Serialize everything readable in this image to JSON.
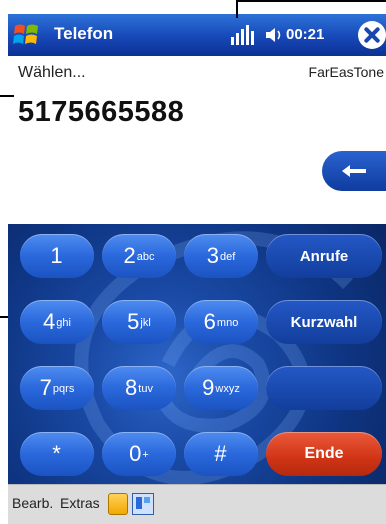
{
  "titlebar": {
    "title": "Telefon",
    "time": "00:21",
    "icons": [
      "windows-start-icon",
      "signal-icon",
      "volume-icon",
      "close-icon"
    ]
  },
  "status": {
    "left": "Wählen...",
    "carrier": "FarEasTone"
  },
  "dial": {
    "number": "5175665588"
  },
  "keypad": {
    "keys": [
      {
        "digit": "1",
        "letters": ""
      },
      {
        "digit": "2",
        "letters": "abc"
      },
      {
        "digit": "3",
        "letters": "def"
      },
      {
        "digit": "4",
        "letters": "ghi"
      },
      {
        "digit": "5",
        "letters": "jkl"
      },
      {
        "digit": "6",
        "letters": "mno"
      },
      {
        "digit": "7",
        "letters": "pqrs"
      },
      {
        "digit": "8",
        "letters": "tuv"
      },
      {
        "digit": "9",
        "letters": "wxyz"
      },
      {
        "digit": "*",
        "letters": ""
      },
      {
        "digit": "0",
        "letters": "+"
      },
      {
        "digit": "#",
        "letters": ""
      }
    ],
    "calls_label": "Anrufe",
    "speed_dial_label": "Kurzwahl",
    "end_label": "Ende"
  },
  "menubar": {
    "items": [
      "Bearb.",
      "Extras"
    ]
  },
  "colors": {
    "titlebar": "#1748b8",
    "keypad_bg": "#1a4aa6",
    "key": "#2a68dc",
    "end_key": "#d03416",
    "menubar": "#dcdcdc"
  }
}
